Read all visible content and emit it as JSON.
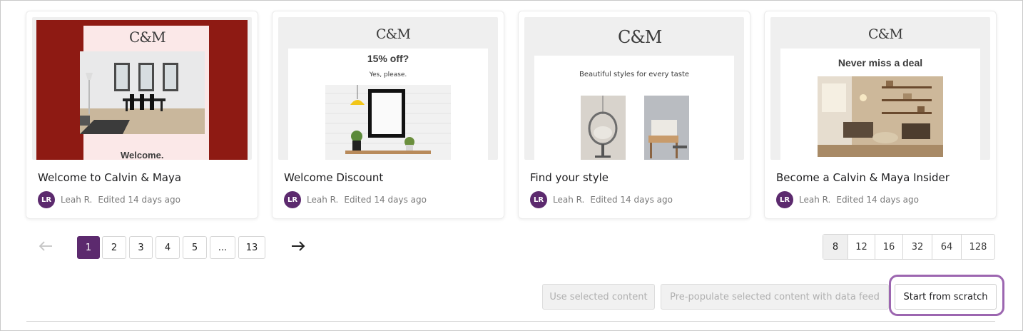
{
  "templates": [
    {
      "title": "Welcome to Calvin & Maya",
      "thumbnail": {
        "logo": "C&M",
        "headline": "Welcome.",
        "accent": "#8e1a13"
      },
      "author_initials": "LR",
      "author": "Leah R.",
      "edited": "Edited 14 days ago"
    },
    {
      "title": "Welcome Discount",
      "thumbnail": {
        "logo": "C&M",
        "headline": "15% off?",
        "subline": "Yes, please."
      },
      "author_initials": "LR",
      "author": "Leah R.",
      "edited": "Edited 14 days ago"
    },
    {
      "title": "Find your style",
      "thumbnail": {
        "logo": "C&M",
        "subline": "Beautiful styles for every taste"
      },
      "author_initials": "LR",
      "author": "Leah R.",
      "edited": "Edited 14 days ago"
    },
    {
      "title": "Become a Calvin & Maya Insider",
      "thumbnail": {
        "logo": "C&M",
        "headline": "Never miss a deal"
      },
      "author_initials": "LR",
      "author": "Leah R.",
      "edited": "Edited 14 days ago"
    }
  ],
  "pagination": {
    "prev_icon": "arrow-left-icon",
    "next_icon": "arrow-right-icon",
    "pages": [
      "1",
      "2",
      "3",
      "4",
      "5",
      "...",
      "13"
    ],
    "current": "1"
  },
  "page_sizes": {
    "options": [
      "8",
      "12",
      "16",
      "32",
      "64",
      "128"
    ],
    "selected": "8"
  },
  "actions": {
    "use_selected": "Use selected content",
    "prepopulate": "Pre-populate selected content with data feed",
    "start_scratch": "Start from scratch"
  },
  "colors": {
    "brand_purple": "#5c2a6e",
    "highlight_purple": "#9c66b0"
  }
}
